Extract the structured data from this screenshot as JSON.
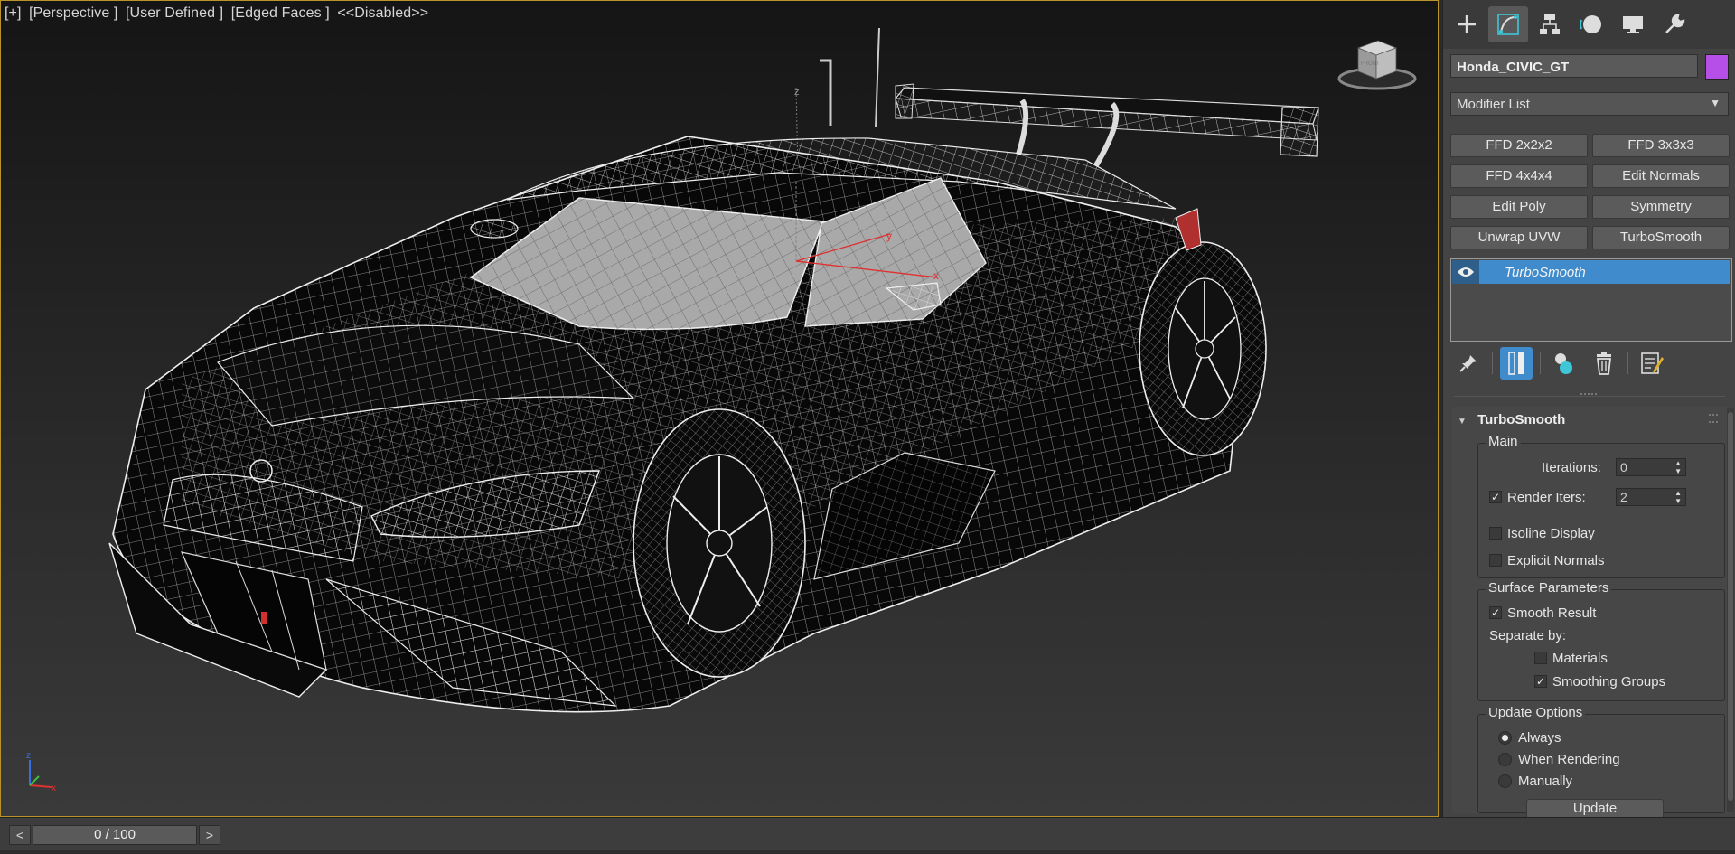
{
  "viewport": {
    "label_parts": [
      "[+]",
      "[Perspective ]",
      "[User Defined ]",
      "[Edged Faces ]",
      "<<Disabled>>"
    ],
    "viewcube_face": "FRONT",
    "axis_labels": {
      "x": "x",
      "y": "y",
      "z": "z"
    },
    "gizmo_labels": {
      "x": "x",
      "y": "y",
      "z": "z"
    }
  },
  "command_panel": {
    "tabs": [
      {
        "name": "create",
        "icon": "plus-icon"
      },
      {
        "name": "modify",
        "icon": "modify-curve-icon"
      },
      {
        "name": "hierarchy",
        "icon": "hierarchy-icon"
      },
      {
        "name": "motion",
        "icon": "motion-circle-icon"
      },
      {
        "name": "display",
        "icon": "display-monitor-icon"
      },
      {
        "name": "utilities",
        "icon": "wrench-icon"
      }
    ],
    "active_tab": "modify",
    "object_name": "Honda_CIVIC_GT",
    "object_color": "#b64fe8",
    "modifier_list": "Modifier List",
    "modifier_buttons": [
      "FFD 2x2x2",
      "FFD 3x3x3",
      "FFD 4x4x4",
      "Edit Normals",
      "Edit Poly",
      "Symmetry",
      "Unwrap UVW",
      "TurboSmooth"
    ],
    "stack": [
      {
        "label": "TurboSmooth",
        "selected": true
      }
    ],
    "stack_tools": [
      "pin-stack-icon",
      "show-end-result-icon",
      "make-unique-icon",
      "remove-modifier-icon",
      "configure-sets-icon"
    ]
  },
  "turbosmooth": {
    "title": "TurboSmooth",
    "main": {
      "title": "Main",
      "iterations_label": "Iterations:",
      "iterations_value": "0",
      "render_iters_label": "Render Iters:",
      "render_iters_value": "2",
      "render_iters_checked": true,
      "isoline_label": "Isoline Display",
      "isoline_checked": false,
      "explicit_normals_label": "Explicit Normals",
      "explicit_normals_checked": false
    },
    "surface": {
      "title": "Surface Parameters",
      "smooth_result_label": "Smooth Result",
      "smooth_result_checked": true,
      "separate_by_label": "Separate by:",
      "materials_label": "Materials",
      "materials_checked": false,
      "smoothing_groups_label": "Smoothing Groups",
      "smoothing_groups_checked": true
    },
    "update": {
      "title": "Update Options",
      "always_label": "Always",
      "when_rendering_label": "When Rendering",
      "manually_label": "Manually",
      "selected": "Always",
      "update_button": "Update"
    }
  },
  "timeline": {
    "frame_display": "0 / 100",
    "prev_label": "<",
    "next_label": ">"
  },
  "colors": {
    "accent_blue": "#3f8bcc",
    "viewport_border": "#b8942a",
    "gizmo_red": "#e03030"
  }
}
